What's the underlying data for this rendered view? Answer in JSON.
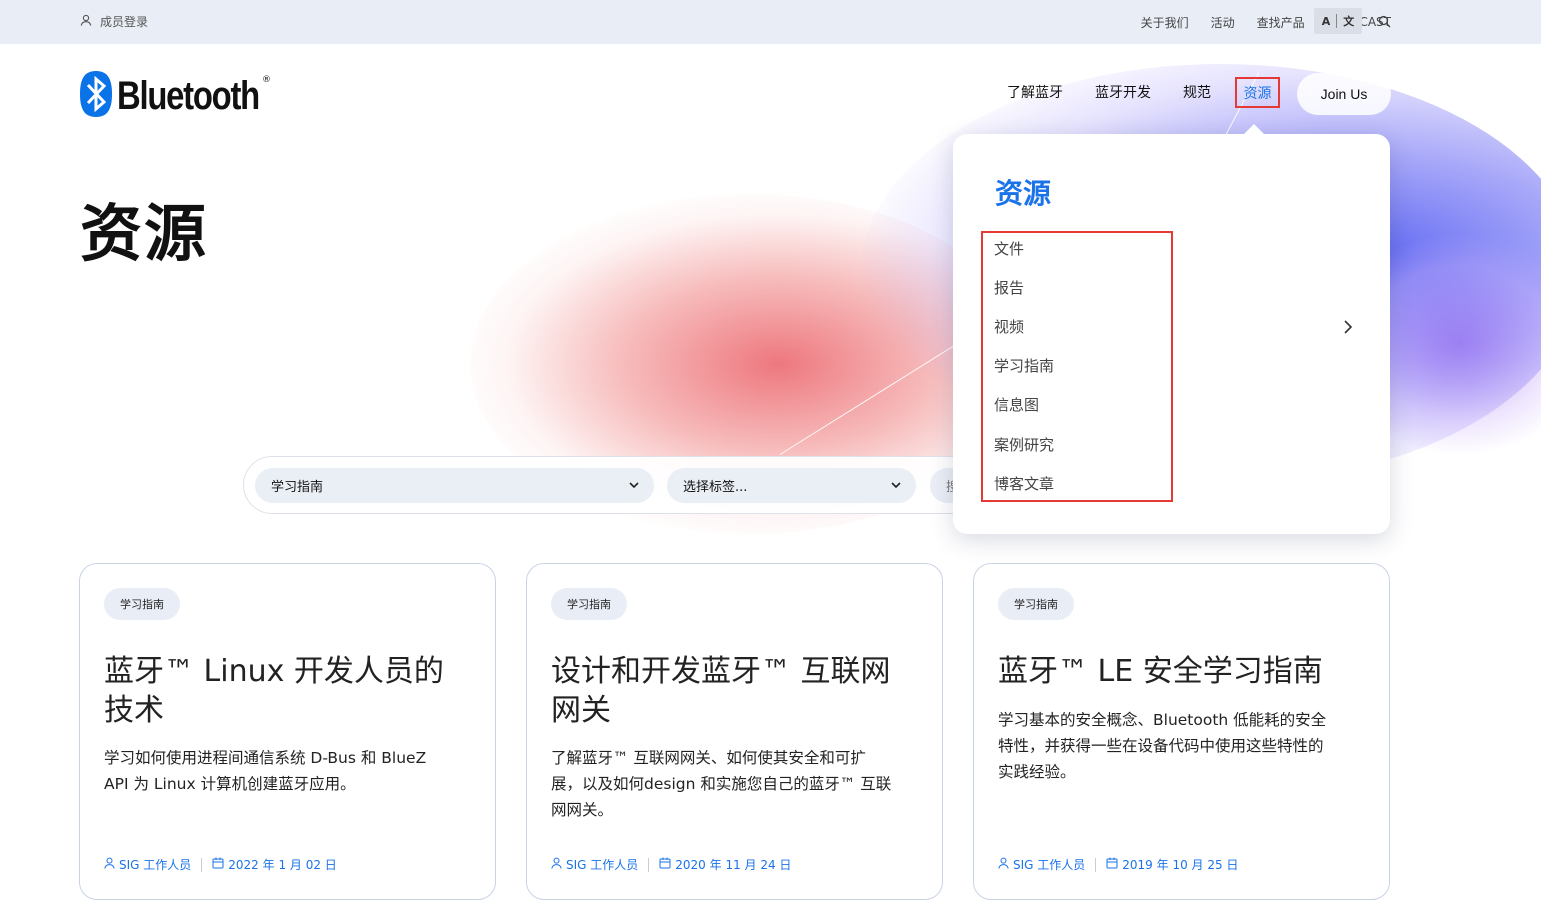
{
  "topbar": {
    "member_login": "成员登录",
    "links": [
      "关于我们",
      "活动",
      "查找产品",
      "AURACAST"
    ],
    "lang_a": "A",
    "lang_zh": "文"
  },
  "header": {
    "logo_text": "Bluetooth",
    "logo_reg": "®",
    "nav": [
      "了解蓝牙",
      "蓝牙开发",
      "规范"
    ],
    "nav_active": "资源",
    "join_label": "Join Us"
  },
  "page": {
    "title": "资源"
  },
  "filters": {
    "category_value": "学习指南",
    "tags_placeholder": "选择标签...",
    "search_partial": "搜"
  },
  "dropdown": {
    "title": "资源",
    "items": [
      "文件",
      "报告",
      "视频",
      "学习指南",
      "信息图",
      "案例研究",
      "博客文章"
    ]
  },
  "cards": [
    {
      "tag": "学习指南",
      "title_line1": "蓝牙™ Linux 开发人员的",
      "title_line2": "技术",
      "desc_line1": "学习如何使用进程间通信系统 D-Bus 和 BlueZ",
      "desc_line2": "API 为 Linux 计算机创建蓝牙应用。",
      "desc_line3": "",
      "author": "SIG 工作人员",
      "date": "2022 年 1 月 02 日"
    },
    {
      "tag": "学习指南",
      "title_line1": "设计和开发蓝牙™ 互联网",
      "title_line2": "网关",
      "desc_line1": "了解蓝牙™ 互联网网关、如何使其安全和可扩",
      "desc_line2": "展，以及如何design 和实施您自己的蓝牙™ 互联",
      "desc_line3": "网网关。",
      "author": "SIG 工作人员",
      "date": "2020 年 11 月 24 日"
    },
    {
      "tag": "学习指南",
      "title_line1": "蓝牙™ LE 安全学习指南",
      "title_line2": "",
      "desc_line1": "学习基本的安全概念、Bluetooth 低能耗的安全",
      "desc_line2": "特性，并获得一些在设备代码中使用这些特性的",
      "desc_line3": "实践经验。",
      "author": "SIG 工作人员",
      "date": "2019 年 10 月 25 日"
    }
  ],
  "colors": {
    "accent_blue": "#1a73e8",
    "highlight_red": "#e53935",
    "topbar_bg": "#e9eef6"
  }
}
